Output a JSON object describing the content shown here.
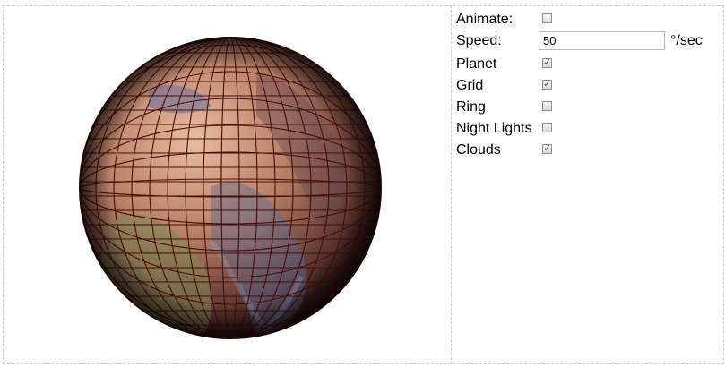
{
  "controls": {
    "animate": {
      "label": "Animate:",
      "checked": false
    },
    "speed": {
      "label": "Speed:",
      "value": "50",
      "unit": "°/sec"
    },
    "planet": {
      "label": "Planet",
      "checked": true
    },
    "grid": {
      "label": "Grid",
      "checked": true
    },
    "ring": {
      "label": "Ring",
      "checked": false
    },
    "night_lights": {
      "label": "Night Lights",
      "checked": false
    },
    "clouds": {
      "label": "Clouds",
      "checked": true
    }
  }
}
